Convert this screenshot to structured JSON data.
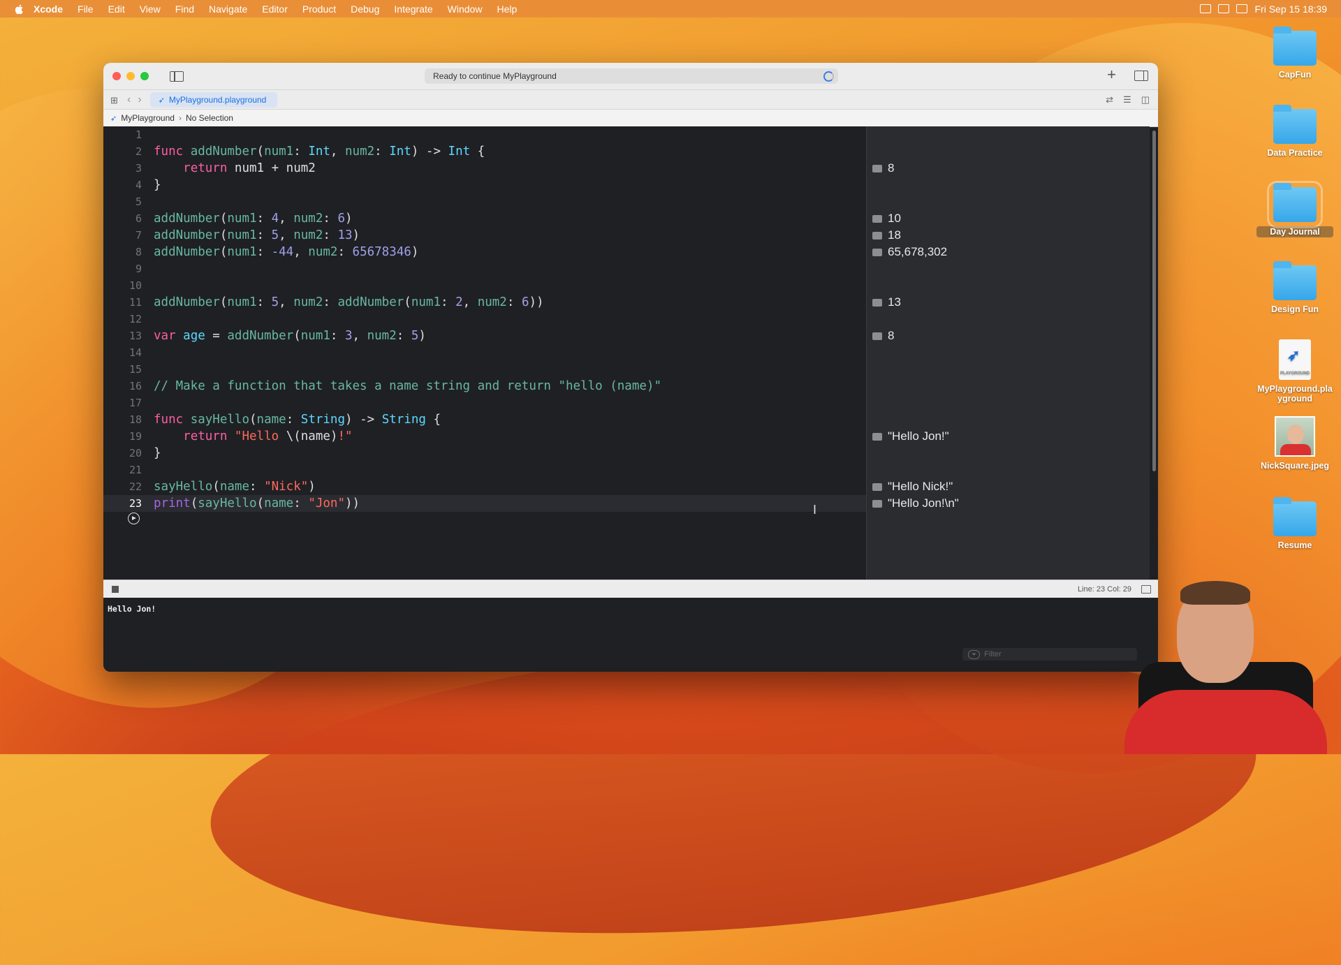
{
  "menubar": {
    "app": "Xcode",
    "items": [
      "File",
      "Edit",
      "View",
      "Find",
      "Navigate",
      "Editor",
      "Product",
      "Debug",
      "Integrate",
      "Window",
      "Help"
    ],
    "datetime": "Fri Sep 15  18:39"
  },
  "window": {
    "activity": "Ready to continue MyPlayground",
    "tab_label": "MyPlayground.playground",
    "breadcrumb": {
      "project": "MyPlayground",
      "selection": "No Selection"
    }
  },
  "editor": {
    "current_line": 23,
    "line_numbers": [
      "1",
      "2",
      "3",
      "4",
      "5",
      "6",
      "7",
      "8",
      "9",
      "10",
      "11",
      "12",
      "13",
      "14",
      "15",
      "16",
      "17",
      "18",
      "19",
      "20",
      "21",
      "22",
      "23"
    ]
  },
  "results": {
    "r3": "8",
    "r6": "10",
    "r7": "18",
    "r8": "65,678,302",
    "r11": "13",
    "r13": "8",
    "r19": "\"Hello Jon!\"",
    "r22": "\"Hello Nick!\"",
    "r23": "\"Hello Jon!\\n\""
  },
  "statusbar": {
    "position": "Line: 23  Col: 29"
  },
  "console": {
    "output": "Hello Jon!",
    "filter_placeholder": "Filter"
  },
  "desktop": {
    "icons": [
      {
        "label": "CapFun",
        "kind": "folder"
      },
      {
        "label": "Data Practice",
        "kind": "folder"
      },
      {
        "label": "Day Journal",
        "kind": "folder"
      },
      {
        "label": "Design Fun",
        "kind": "folder"
      },
      {
        "label": "MyPlayground.pla\nyground",
        "kind": "playground"
      },
      {
        "label": "NickSquare.jpeg",
        "kind": "image"
      },
      {
        "label": "Resume",
        "kind": "folder"
      }
    ]
  },
  "colors": {
    "keyword": "#fc5fa3",
    "function": "#67b7a4",
    "type": "#5dd8ff",
    "string": "#fc6a5d",
    "comment": "#6c7986",
    "accent": "#1c6fe0"
  }
}
